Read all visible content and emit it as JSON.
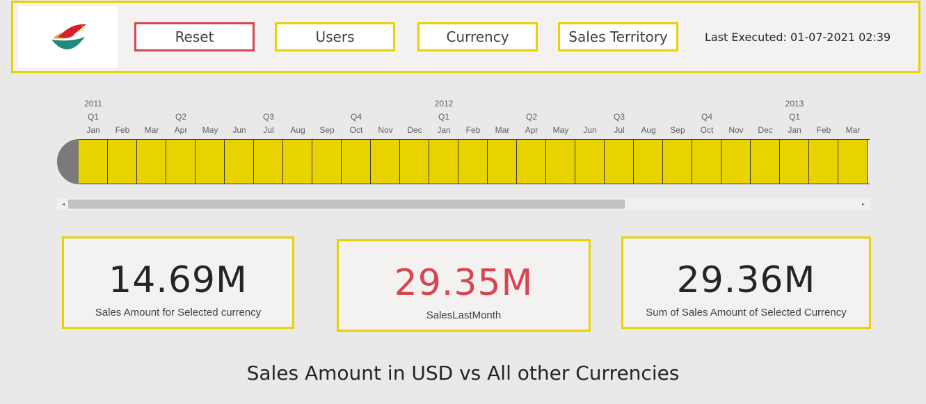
{
  "header": {
    "buttons": {
      "reset": "Reset",
      "users": "Users",
      "currency": "Currency",
      "sales_territory": "Sales Territory"
    },
    "last_executed": "Last Executed: 01-07-2021 02:39"
  },
  "timeline": {
    "columns": [
      {
        "year": "2011",
        "quarter": "Q1",
        "month": "Jan"
      },
      {
        "year": "",
        "quarter": "",
        "month": "Feb"
      },
      {
        "year": "",
        "quarter": "",
        "month": "Mar"
      },
      {
        "year": "",
        "quarter": "Q2",
        "month": "Apr"
      },
      {
        "year": "",
        "quarter": "",
        "month": "May"
      },
      {
        "year": "",
        "quarter": "",
        "month": "Jun"
      },
      {
        "year": "",
        "quarter": "Q3",
        "month": "Jul"
      },
      {
        "year": "",
        "quarter": "",
        "month": "Aug"
      },
      {
        "year": "",
        "quarter": "",
        "month": "Sep"
      },
      {
        "year": "",
        "quarter": "Q4",
        "month": "Oct"
      },
      {
        "year": "",
        "quarter": "",
        "month": "Nov"
      },
      {
        "year": "",
        "quarter": "",
        "month": "Dec"
      },
      {
        "year": "2012",
        "quarter": "Q1",
        "month": "Jan"
      },
      {
        "year": "",
        "quarter": "",
        "month": "Feb"
      },
      {
        "year": "",
        "quarter": "",
        "month": "Mar"
      },
      {
        "year": "",
        "quarter": "Q2",
        "month": "Apr"
      },
      {
        "year": "",
        "quarter": "",
        "month": "May"
      },
      {
        "year": "",
        "quarter": "",
        "month": "Jun"
      },
      {
        "year": "",
        "quarter": "Q3",
        "month": "Jul"
      },
      {
        "year": "",
        "quarter": "",
        "month": "Aug"
      },
      {
        "year": "",
        "quarter": "",
        "month": "Sep"
      },
      {
        "year": "",
        "quarter": "Q4",
        "month": "Oct"
      },
      {
        "year": "",
        "quarter": "",
        "month": "Nov"
      },
      {
        "year": "",
        "quarter": "",
        "month": "Dec"
      },
      {
        "year": "2013",
        "quarter": "Q1",
        "month": "Jan"
      },
      {
        "year": "",
        "quarter": "",
        "month": "Feb"
      },
      {
        "year": "",
        "quarter": "",
        "month": "Mar"
      }
    ],
    "selection_color": "#e8d300"
  },
  "scrollbar": {
    "left_arrow_icon": "scroll-left-icon",
    "right_arrow_icon": "scroll-right-icon"
  },
  "cards": [
    {
      "value": "14.69M",
      "label": "Sales Amount for Selected currency"
    },
    {
      "value": "29.35M",
      "label": "SalesLastMonth"
    },
    {
      "value": "29.36M",
      "label": "Sum of Sales Amount of Selected Currency"
    }
  ],
  "chart_title": "Sales Amount in USD vs All other Currencies",
  "colors": {
    "accent": "#e8d300",
    "reset_border": "#d64550",
    "highlight_value": "#d64550"
  }
}
